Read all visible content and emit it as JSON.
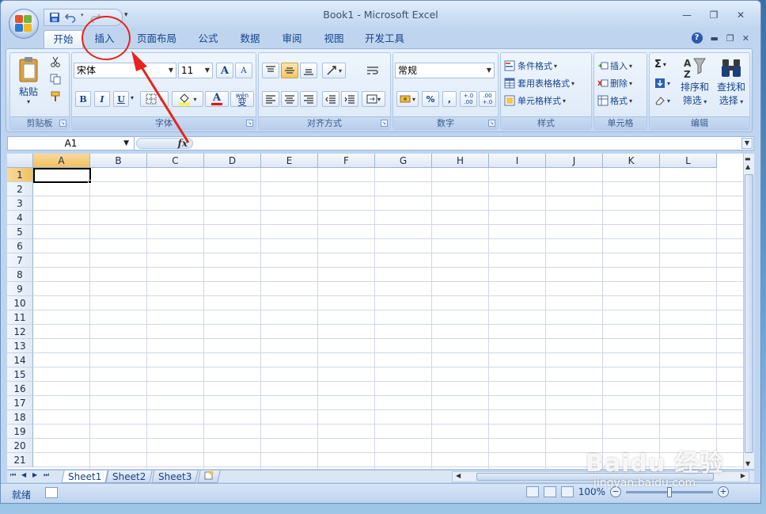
{
  "window": {
    "title": "Book1 - Microsoft Excel",
    "minimize": "—",
    "restore": "❐",
    "close": "✕"
  },
  "ribbon_tabs": [
    {
      "label": "开始",
      "active": true
    },
    {
      "label": "插入",
      "active": false
    },
    {
      "label": "页面布局",
      "active": false
    },
    {
      "label": "公式",
      "active": false
    },
    {
      "label": "数据",
      "active": false
    },
    {
      "label": "审阅",
      "active": false
    },
    {
      "label": "视图",
      "active": false
    },
    {
      "label": "开发工具",
      "active": false
    }
  ],
  "help": {
    "icon": "?",
    "min": "▬",
    "restore": "❐",
    "close": "✕"
  },
  "clipboard": {
    "paste_label": "粘贴",
    "group_label": "剪贴板"
  },
  "font": {
    "font_name": "宋体",
    "font_size": "11",
    "grow": "A",
    "shrink": "A",
    "bold": "B",
    "italic": "I",
    "underline": "U",
    "font_color_glyph": "A",
    "phonetic": "wén",
    "phonetic_char": "变",
    "group_label": "字体"
  },
  "alignment": {
    "group_label": "对齐方式"
  },
  "number": {
    "format": "常规",
    "percent": "%",
    "comma": ",",
    "inc_decimal": "+.0 .00",
    "dec_decimal": ".00 +.0",
    "group_label": "数字"
  },
  "styles": {
    "conditional": "条件格式",
    "table_format": "套用表格格式",
    "cell_styles": "单元格样式",
    "group_label": "样式"
  },
  "cells": {
    "insert": "插入",
    "delete": "删除",
    "format": "格式",
    "group_label": "单元格"
  },
  "editing": {
    "sum": "Σ",
    "sort_line1": "排序和",
    "sort_line2": "筛选",
    "find_line1": "查找和",
    "find_line2": "选择",
    "group_label": "编辑"
  },
  "formula_bar": {
    "name_box": "A1",
    "fx": "fx",
    "value": ""
  },
  "grid": {
    "columns": [
      "A",
      "B",
      "C",
      "D",
      "E",
      "F",
      "G",
      "H",
      "I",
      "J",
      "K",
      "L"
    ],
    "rows": [
      "1",
      "2",
      "3",
      "4",
      "5",
      "6",
      "7",
      "8",
      "9",
      "10",
      "11",
      "12",
      "13",
      "14",
      "15",
      "16",
      "17",
      "18",
      "19",
      "20",
      "21"
    ],
    "active_cell": "A1"
  },
  "sheets": [
    {
      "name": "Sheet1",
      "active": true
    },
    {
      "name": "Sheet2",
      "active": false
    },
    {
      "name": "Sheet3",
      "active": false
    }
  ],
  "status": {
    "ready": "就绪",
    "zoom": "100%",
    "zoom_out": "−",
    "zoom_in": "+"
  },
  "watermark": {
    "brand": "Baidu 经验",
    "url": "jingyan.baidu.com"
  },
  "colors": {
    "annotation": "#e8231b",
    "ribbon_text": "#15428b",
    "selected_header": "#f1c15f"
  }
}
